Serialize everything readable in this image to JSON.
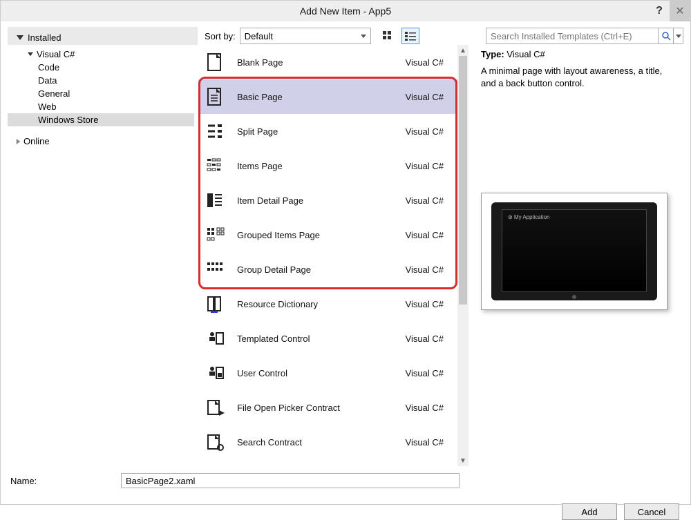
{
  "window": {
    "title": "Add New Item - App5"
  },
  "tree": {
    "header": "Installed",
    "root1": "Visual C#",
    "children": [
      "Code",
      "Data",
      "General",
      "Web",
      "Windows Store"
    ],
    "root2": "Online"
  },
  "sort": {
    "label": "Sort by:",
    "value": "Default"
  },
  "search": {
    "placeholder": "Search Installed Templates (Ctrl+E)"
  },
  "templates": [
    {
      "name": "Blank Page",
      "lang": "Visual C#"
    },
    {
      "name": "Basic Page",
      "lang": "Visual C#",
      "selected": true
    },
    {
      "name": "Split Page",
      "lang": "Visual C#"
    },
    {
      "name": "Items Page",
      "lang": "Visual C#"
    },
    {
      "name": "Item Detail Page",
      "lang": "Visual C#"
    },
    {
      "name": "Grouped Items Page",
      "lang": "Visual C#"
    },
    {
      "name": "Group Detail Page",
      "lang": "Visual C#"
    },
    {
      "name": "Resource Dictionary",
      "lang": "Visual C#"
    },
    {
      "name": "Templated Control",
      "lang": "Visual C#"
    },
    {
      "name": "User Control",
      "lang": "Visual C#"
    },
    {
      "name": "File Open Picker Contract",
      "lang": "Visual C#"
    },
    {
      "name": "Search Contract",
      "lang": "Visual C#"
    }
  ],
  "details": {
    "type_label": "Type:",
    "type_value": "Visual C#",
    "description": "A minimal page with layout awareness, a title, and a back button control.",
    "preview_app_label": "⊛ My Application"
  },
  "name_field": {
    "label": "Name:",
    "value": "BasicPage2.xaml"
  },
  "buttons": {
    "add": "Add",
    "cancel": "Cancel"
  },
  "icons": {
    "help": "?",
    "close": "✕",
    "search": "🔍"
  }
}
